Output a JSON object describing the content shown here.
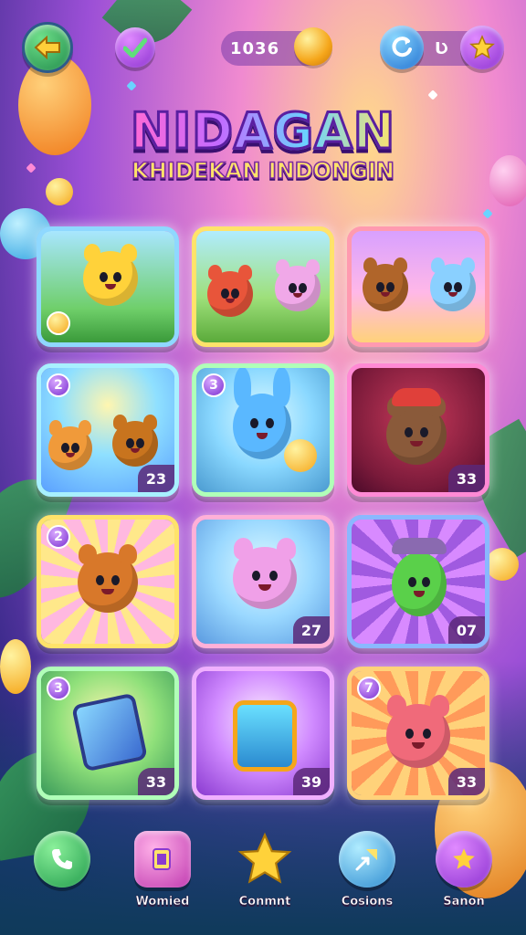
{
  "top_bar": {
    "currency_value": "1036",
    "energy_value": "Ʋ"
  },
  "title": {
    "main": "NIDAGAN",
    "subtitle": "KHIDEKAN INDONGIN"
  },
  "levels": [
    {
      "badge": "",
      "tag": ""
    },
    {
      "badge": "",
      "tag": ""
    },
    {
      "badge": "",
      "tag": ""
    },
    {
      "badge": "2",
      "tag": "23"
    },
    {
      "badge": "3",
      "tag": ""
    },
    {
      "badge": "",
      "tag": "33"
    },
    {
      "badge": "2",
      "tag": ""
    },
    {
      "badge": "",
      "tag": "27"
    },
    {
      "badge": "",
      "tag": "07"
    },
    {
      "badge": "3",
      "tag": "33"
    },
    {
      "badge": "",
      "tag": "39"
    },
    {
      "badge": "7",
      "tag": "33"
    }
  ],
  "bottom_nav": [
    {
      "label": "Womied",
      "icon": "phone-icon"
    },
    {
      "label": "Conmnt",
      "icon": "cards-icon"
    },
    {
      "label": "Cosions",
      "icon": "star-icon"
    },
    {
      "label": "Sanon",
      "icon": "arrow-icon"
    }
  ],
  "colors": {
    "accent_purple": "#8a2fd0",
    "accent_gold": "#f5a61a",
    "accent_green": "#1f8a4a"
  }
}
